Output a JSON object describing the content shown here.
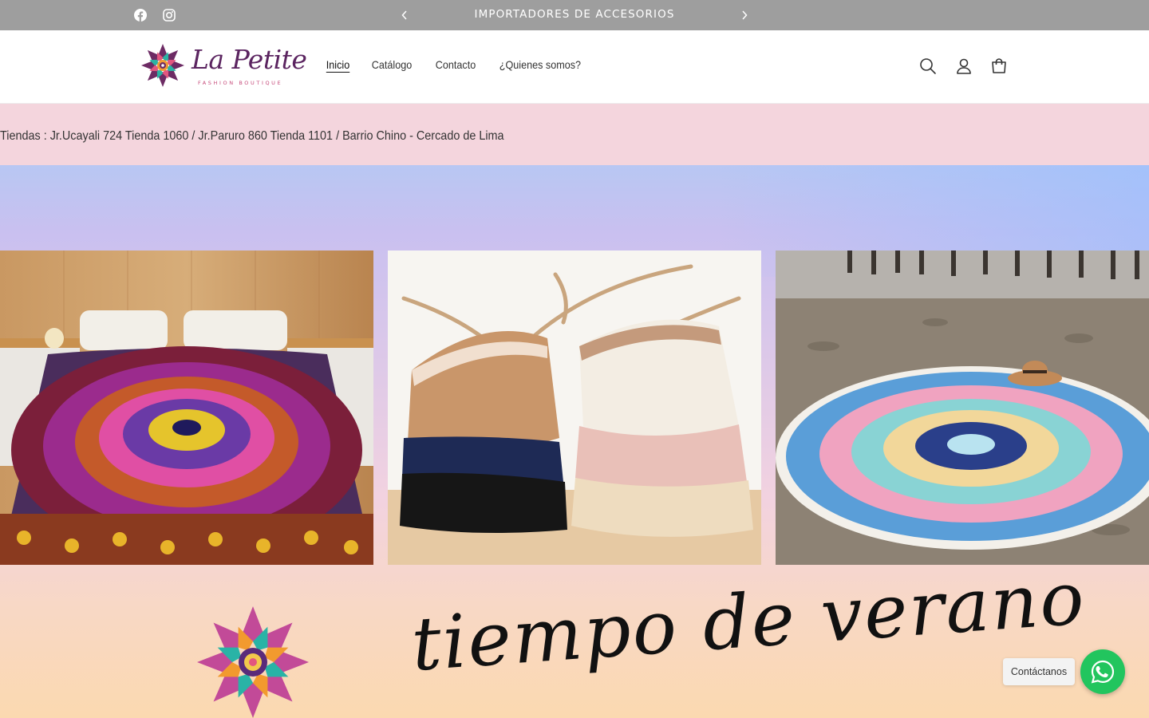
{
  "announcement": {
    "text": "IMPORTADORES DE ACCESORIOS",
    "prev_icon": "chevron-left-icon",
    "next_icon": "chevron-right-icon",
    "social": [
      "facebook-icon",
      "instagram-icon"
    ]
  },
  "header": {
    "logo": {
      "title": "La Petite",
      "subtitle": "FASHION BOUTIQUE"
    },
    "nav": [
      {
        "label": "Inicio",
        "active": true
      },
      {
        "label": "Catálogo"
      },
      {
        "label": "Contacto"
      },
      {
        "label": "¿Quienes somos?"
      }
    ],
    "icons": [
      "search-icon",
      "account-icon",
      "cart-icon"
    ]
  },
  "store_info": {
    "text": "Tiendas : Jr.Ucayali 724 Tienda 1060 / Jr.Paruro 860 Tienda 1101 / Barrio Chino - Cercado de Lima"
  },
  "hero": {
    "headline": "tiempo de verano",
    "panels": [
      "mandala-bedspread-image",
      "straw-visor-hats-image",
      "round-beach-towel-image"
    ]
  },
  "chat": {
    "label": "Contáctanos",
    "icon": "whatsapp-icon",
    "color": "#22c55e"
  },
  "colors": {
    "announcement_bg": "#9e9e9e",
    "info_strip_bg": "#f4d5dd",
    "logo_purple": "#5b2460"
  }
}
